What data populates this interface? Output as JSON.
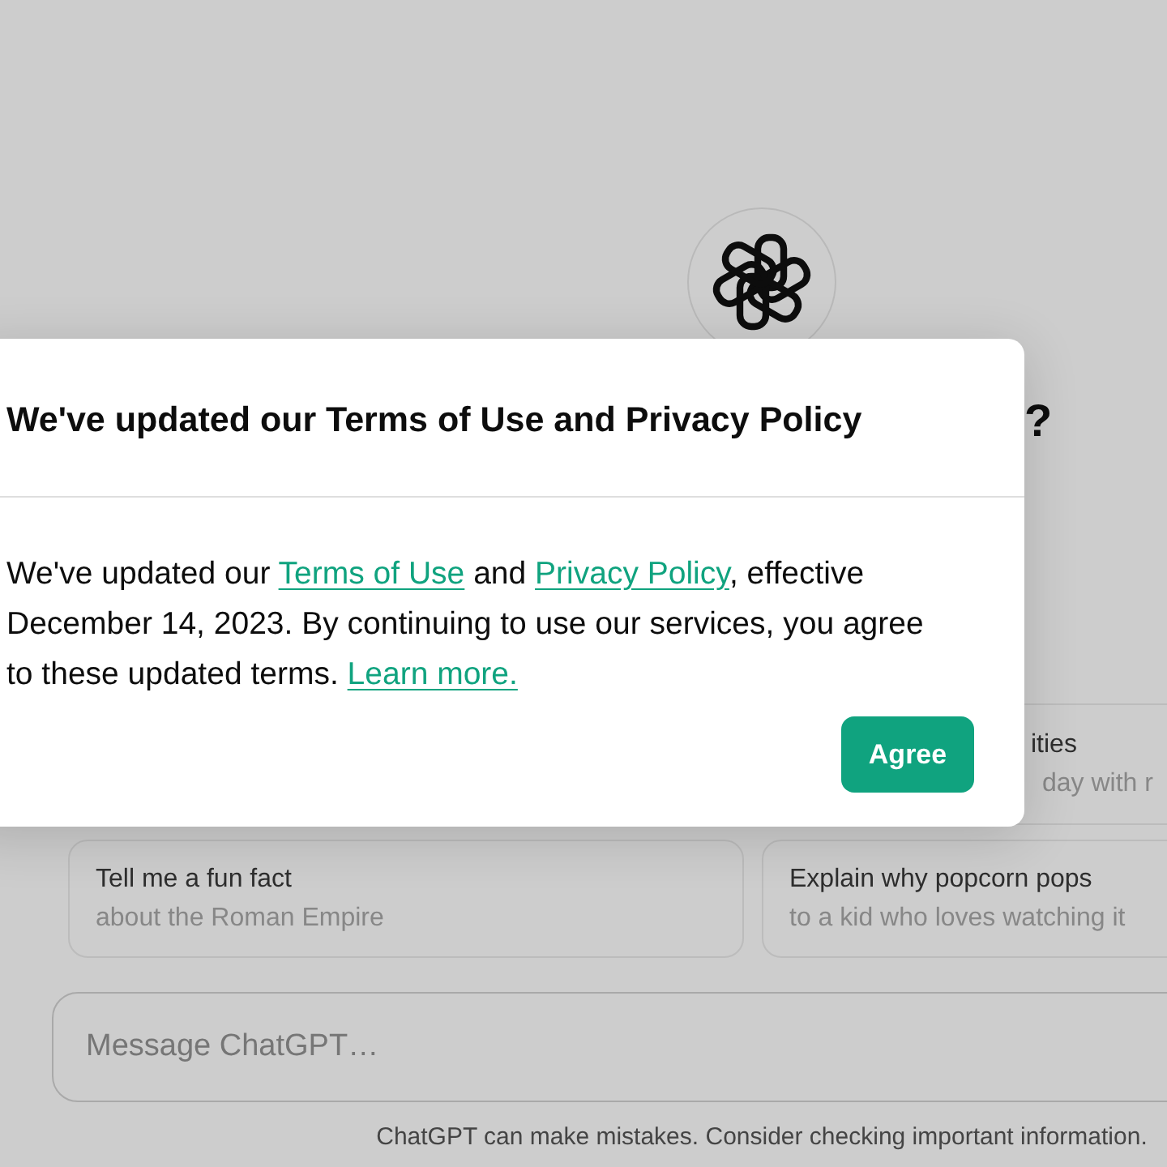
{
  "heading": "?",
  "suggestions": [
    {
      "title": "ities",
      "subtitle": "day with r"
    },
    {
      "title": "Tell me a fun fact",
      "subtitle": "about the Roman Empire"
    },
    {
      "title": "Explain why popcorn pops",
      "subtitle": "to a kid who loves watching it"
    }
  ],
  "message_field": {
    "placeholder": "Message ChatGPT…"
  },
  "footer_note": "ChatGPT can make mistakes. Consider checking important information.",
  "dialog": {
    "title": "We've updated our Terms of Use and Privacy Policy",
    "body": [
      {
        "kind": "text",
        "text": "We've updated our "
      },
      {
        "kind": "link",
        "text": "Terms of Use"
      },
      {
        "kind": "text",
        "text": " and "
      },
      {
        "kind": "link",
        "text": "Privacy Policy"
      },
      {
        "kind": "text",
        "text": ", effective December 14, 2023. By continuing to use our services, you agree to these updated terms. "
      },
      {
        "kind": "link",
        "text": "Learn more."
      }
    ],
    "buttons": [
      "Agree"
    ]
  }
}
